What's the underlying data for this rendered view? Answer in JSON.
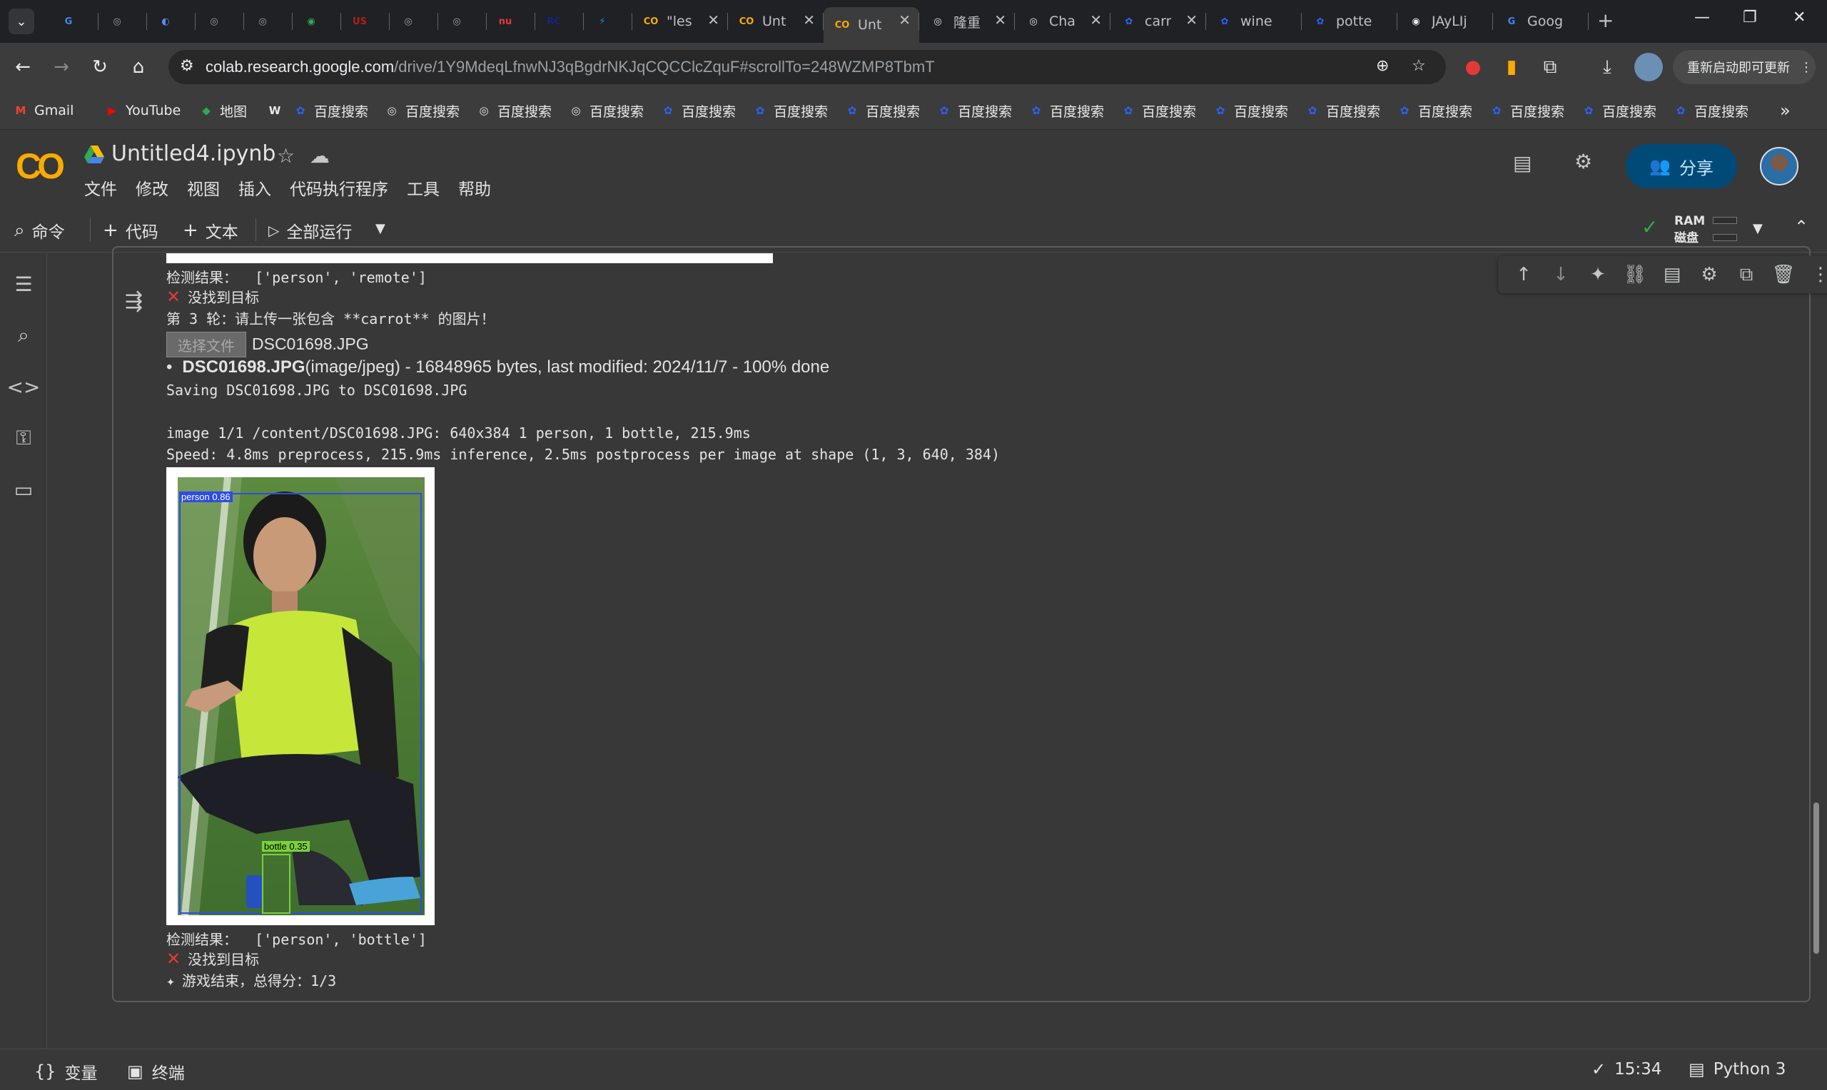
{
  "browser": {
    "tabs": [
      {
        "title": "",
        "favicon": "G",
        "favcolor": "#4285f4"
      },
      {
        "title": "",
        "favicon": "◎",
        "favcolor": "#9aa0a6"
      },
      {
        "title": "",
        "favicon": "◐",
        "favcolor": "#5b8def"
      },
      {
        "title": "",
        "favicon": "◎",
        "favcolor": "#9aa0a6"
      },
      {
        "title": "",
        "favicon": "◎",
        "favcolor": "#9aa0a6"
      },
      {
        "title": "",
        "favicon": "◉",
        "favcolor": "#34a853"
      },
      {
        "title": "",
        "favicon": "US",
        "favcolor": "#b71c1c"
      },
      {
        "title": "",
        "favicon": "◎",
        "favcolor": "#9aa0a6"
      },
      {
        "title": "",
        "favicon": "◎",
        "favcolor": "#9aa0a6"
      },
      {
        "title": "",
        "favicon": "nu",
        "favcolor": "#e53935"
      },
      {
        "title": "",
        "favicon": "RC",
        "favcolor": "#1a237e"
      },
      {
        "title": "",
        "favicon": "⚡",
        "favcolor": "#1e88e5"
      },
      {
        "title": "\"les",
        "favicon": "CO",
        "favcolor": "#f9ab00"
      },
      {
        "title": "Unt",
        "favicon": "CO",
        "favcolor": "#f9ab00"
      },
      {
        "title": "Unt",
        "favicon": "CO",
        "favcolor": "#f9ab00"
      },
      {
        "title": "隆重",
        "favicon": "◎",
        "favcolor": "#e8eaed"
      },
      {
        "title": "Cha",
        "favicon": "◎",
        "favcolor": "#e8eaed"
      },
      {
        "title": "carr",
        "favicon": "✿",
        "favcolor": "#2962ff"
      },
      {
        "title": "wine gl",
        "favicon": "✿",
        "favcolor": "#2962ff"
      },
      {
        "title": "potted",
        "favicon": "✿",
        "favcolor": "#2962ff"
      },
      {
        "title": "JAyLIjX",
        "favicon": "◉",
        "favcolor": "#e8eaed"
      },
      {
        "title": "Google",
        "favicon": "G",
        "favcolor": "#4285f4"
      }
    ],
    "url_host": "colab.research.google.com",
    "url_path": "/drive/1Y9MdeqLfnwNJ3qBgdrNKJqCQCClcZquF#scrollTo=248WZMP8TbmT",
    "relaunch_label": "重新启动即可更新",
    "bookmarks": [
      {
        "label": "Gmail",
        "icon": "M",
        "color": "#ea4335"
      },
      {
        "label": "YouTube",
        "icon": "▶",
        "color": "#ff0000"
      },
      {
        "label": "地图",
        "icon": "◆",
        "color": "#34a853"
      },
      {
        "label": "",
        "icon": "W",
        "color": "#e8eaed"
      },
      {
        "label": "百度搜索",
        "icon": "✿",
        "color": "#2962ff"
      },
      {
        "label": "百度搜索",
        "icon": "◎",
        "color": "#e8eaed"
      },
      {
        "label": "百度搜索",
        "icon": "◎",
        "color": "#e8eaed"
      },
      {
        "label": "百度搜索",
        "icon": "◎",
        "color": "#e8eaed"
      },
      {
        "label": "百度搜索",
        "icon": "✿",
        "color": "#2962ff"
      },
      {
        "label": "百度搜索",
        "icon": "✿",
        "color": "#2962ff"
      },
      {
        "label": "百度搜索",
        "icon": "✿",
        "color": "#2962ff"
      },
      {
        "label": "百度搜索",
        "icon": "✿",
        "color": "#2962ff"
      },
      {
        "label": "百度搜索",
        "icon": "✿",
        "color": "#2962ff"
      },
      {
        "label": "百度搜索",
        "icon": "✿",
        "color": "#2962ff"
      },
      {
        "label": "百度搜索",
        "icon": "✿",
        "color": "#2962ff"
      },
      {
        "label": "百度搜索",
        "icon": "✿",
        "color": "#2962ff"
      },
      {
        "label": "百度搜索",
        "icon": "✿",
        "color": "#2962ff"
      },
      {
        "label": "百度搜索",
        "icon": "✿",
        "color": "#2962ff"
      },
      {
        "label": "百度搜索",
        "icon": "✿",
        "color": "#2962ff"
      },
      {
        "label": "百度搜索",
        "icon": "✿",
        "color": "#2962ff"
      }
    ]
  },
  "colab": {
    "notebook_title": "Untitled4.ipynb",
    "menu": [
      "文件",
      "修改",
      "视图",
      "插入",
      "代码执行程序",
      "工具",
      "帮助"
    ],
    "share_label": "分享",
    "toolbar": {
      "command": "命令",
      "code": "代码",
      "text": "文本",
      "run_all": "全部运行"
    },
    "ram_label": "RAM",
    "disk_label": "磁盘"
  },
  "output": {
    "line1": "检测结果：  ['person', 'remote']",
    "line2": "没找到目标",
    "line3": "第 3 轮：请上传一张包含 **carrot** 的图片！",
    "choose_file": "选择文件",
    "chosen_name": "DSC01698.JPG",
    "upload_name": "DSC01698.JPG",
    "upload_meta": "(image/jpeg) - 16848965 bytes, last modified: 2024/11/7 - 100% done",
    "saving": "Saving DSC01698.JPG to DSC01698.JPG",
    "image_line": "image 1/1 /content/DSC01698.JPG: 640x384 1 person, 1 bottle, 215.9ms",
    "speed_line": "Speed: 4.8ms preprocess, 215.9ms inference, 2.5ms postprocess per image at shape (1, 3, 640, 384)",
    "det_person": "person 0.86",
    "det_bottle": "bottle 0.35",
    "result2": "检测结果：  ['person', 'bottle']",
    "notfound2": "没找到目标",
    "gameover": "游戏结束，总得分：1/3"
  },
  "status": {
    "variables": "变量",
    "terminal": "终端",
    "time": "15:34",
    "runtime": "Python 3"
  }
}
